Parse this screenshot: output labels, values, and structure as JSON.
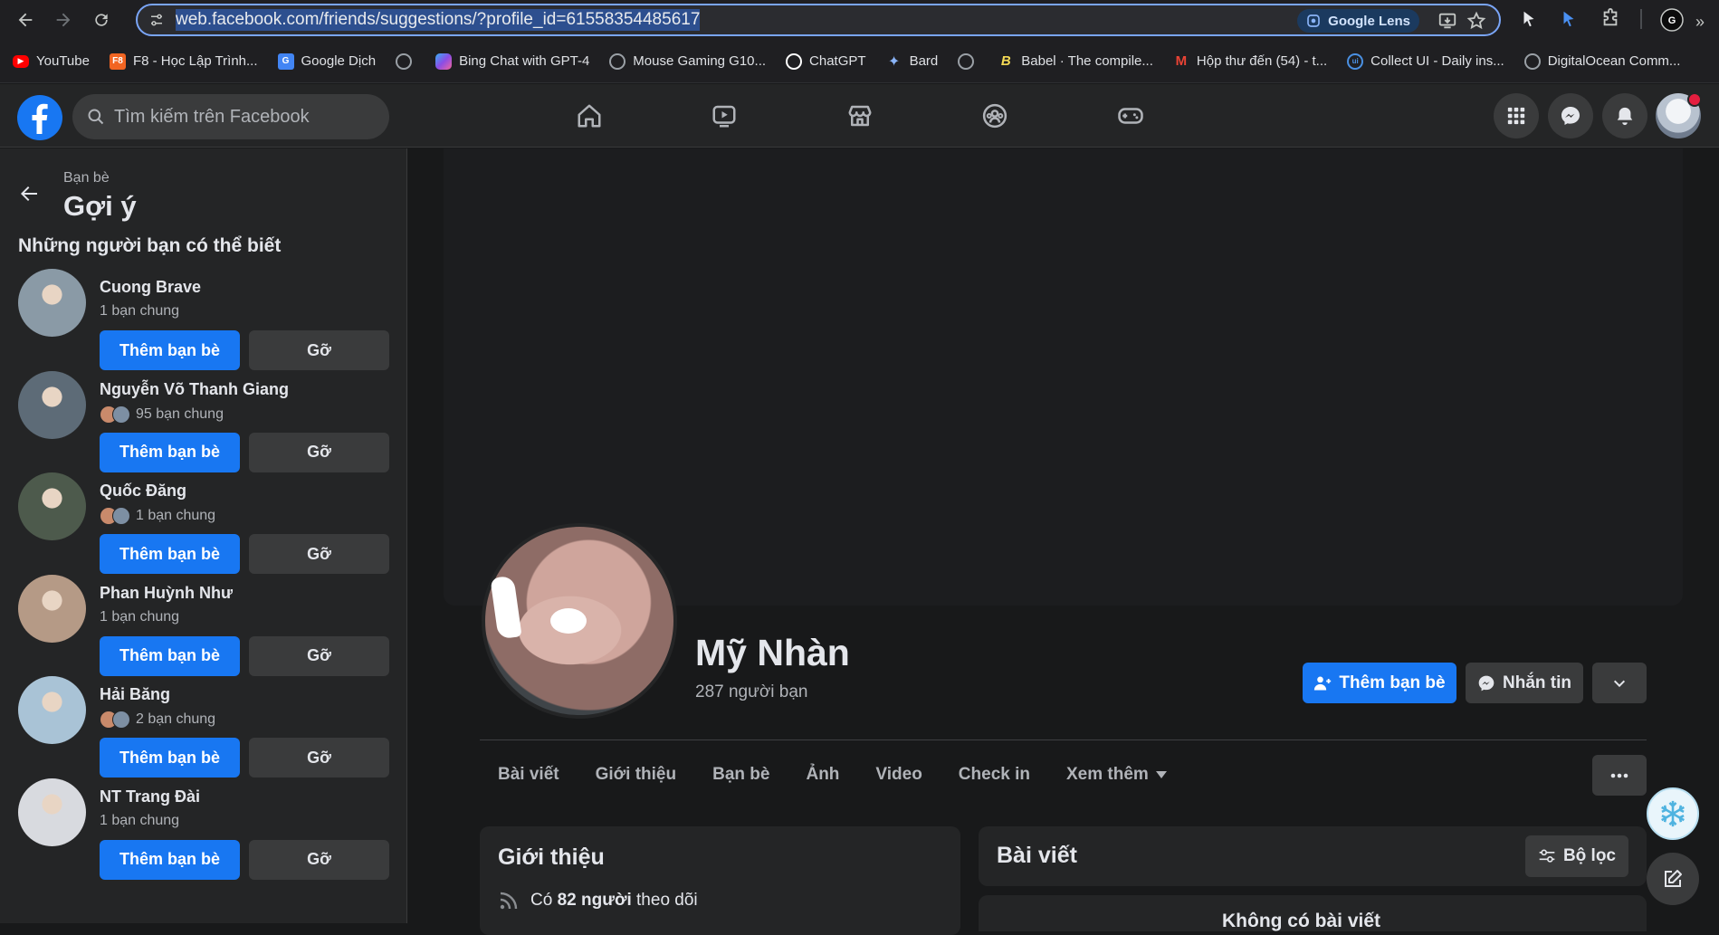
{
  "browser": {
    "url": "web.facebook.com/friends/suggestions/?profile_id=61558354485617",
    "lens_label": "Google Lens",
    "bookmarks": [
      {
        "label": "YouTube",
        "icon": "youtube-icon",
        "color": "#ff0000"
      },
      {
        "label": "F8 - Học Lập Trình...",
        "icon": "f8-icon",
        "color": "#f26522"
      },
      {
        "label": "Google Dịch",
        "icon": "google-translate-icon",
        "color": "#4285f4"
      },
      {
        "label": "",
        "icon": "globe-icon",
        "color": "#9aa0a6"
      },
      {
        "label": "Bing Chat with GPT-4",
        "icon": "bing-icon",
        "color": "#6e5ce6"
      },
      {
        "label": "Mouse Gaming G10...",
        "icon": "globe-icon",
        "color": "#9aa0a6"
      },
      {
        "label": "ChatGPT",
        "icon": "chatgpt-icon",
        "color": "#ffffff"
      },
      {
        "label": "Bard",
        "icon": "bard-icon",
        "color": "#8ab4f8"
      },
      {
        "label": "",
        "icon": "globe-icon",
        "color": "#9aa0a6"
      },
      {
        "label": "Babel · The compile...",
        "icon": "babel-icon",
        "color": "#f5da55"
      },
      {
        "label": "Hộp thư đến (54) - t...",
        "icon": "gmail-icon",
        "color": "#ea4335"
      },
      {
        "label": "Collect UI - Daily ins...",
        "icon": "collectui-icon",
        "color": "#4a90e2"
      },
      {
        "label": "DigitalOcean Comm...",
        "icon": "globe-icon",
        "color": "#9aa0a6"
      }
    ]
  },
  "fb": {
    "search_placeholder": "Tìm kiếm trên Facebook",
    "brand_color": "#1877f2"
  },
  "sidebar": {
    "breadcrumb": "Bạn bè",
    "title": "Gợi ý",
    "section_title": "Những người bạn có thể biết",
    "add_label": "Thêm bạn bè",
    "remove_label": "Gỡ",
    "suggestions": [
      {
        "name": "Cuong Brave",
        "mutual": "1 bạn chung",
        "avatar": "#8a9aa6",
        "has_mini": false
      },
      {
        "name": "Nguyễn Võ Thanh Giang",
        "mutual": "95 bạn chung",
        "avatar": "#5d6b77",
        "has_mini": true
      },
      {
        "name": "Quốc Đăng",
        "mutual": "1 bạn chung",
        "avatar": "#4d5a4c",
        "has_mini": true
      },
      {
        "name": "Phan Huỳnh Như",
        "mutual": "1 bạn chung",
        "avatar": "#b59a86",
        "has_mini": false
      },
      {
        "name": "Hải Băng",
        "mutual": "2 bạn chung",
        "avatar": "#a9c3d6",
        "has_mini": true
      },
      {
        "name": "NT Trang Đài",
        "mutual": "1 bạn chung",
        "avatar": "#d8dadf",
        "has_mini": false
      }
    ]
  },
  "profile": {
    "name": "Mỹ Nhàn",
    "friends": "287 người bạn",
    "add_label": "Thêm bạn bè",
    "message_label": "Nhắn tin",
    "tabs": [
      "Bài viết",
      "Giới thiệu",
      "Bạn bè",
      "Ảnh",
      "Video",
      "Check in",
      "Xem thêm"
    ],
    "intro_title": "Giới thiệu",
    "followers_prefix": "Có ",
    "followers_bold": "82 người",
    "followers_suffix": " theo dõi",
    "posts_title": "Bài viết",
    "filter_label": "Bộ lọc",
    "no_posts": "Không có bài viết"
  }
}
